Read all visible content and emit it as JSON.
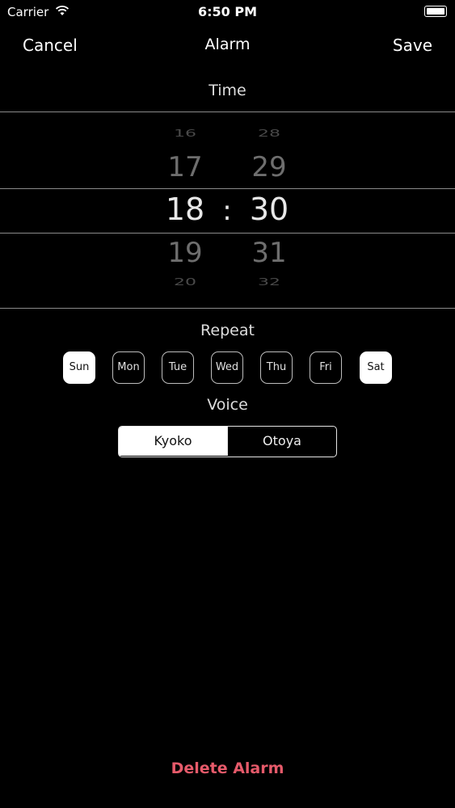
{
  "status_bar": {
    "carrier": "Carrier",
    "time": "6:50 PM",
    "icons": [
      "wifi-icon",
      "battery-icon"
    ]
  },
  "nav": {
    "cancel_label": "Cancel",
    "title": "Alarm",
    "save_label": "Save"
  },
  "time_section": {
    "label": "Time",
    "hours": [
      "16",
      "17",
      "18",
      "19",
      "20"
    ],
    "minutes": [
      "28",
      "29",
      "30",
      "31",
      "32"
    ],
    "separator": ":",
    "selected_hour": "18",
    "selected_minute": "30"
  },
  "repeat_section": {
    "label": "Repeat",
    "days": [
      {
        "label": "Sun",
        "selected": true
      },
      {
        "label": "Mon",
        "selected": false
      },
      {
        "label": "Tue",
        "selected": false
      },
      {
        "label": "Wed",
        "selected": false
      },
      {
        "label": "Thu",
        "selected": false
      },
      {
        "label": "Fri",
        "selected": false
      },
      {
        "label": "Sat",
        "selected": true
      }
    ]
  },
  "voice_section": {
    "label": "Voice",
    "options": [
      "Kyoko",
      "Otoya"
    ],
    "selected": "Kyoko"
  },
  "delete_label": "Delete Alarm",
  "colors": {
    "background": "#000000",
    "delete": "#e65a6a",
    "separator": "#8a8a8a"
  }
}
